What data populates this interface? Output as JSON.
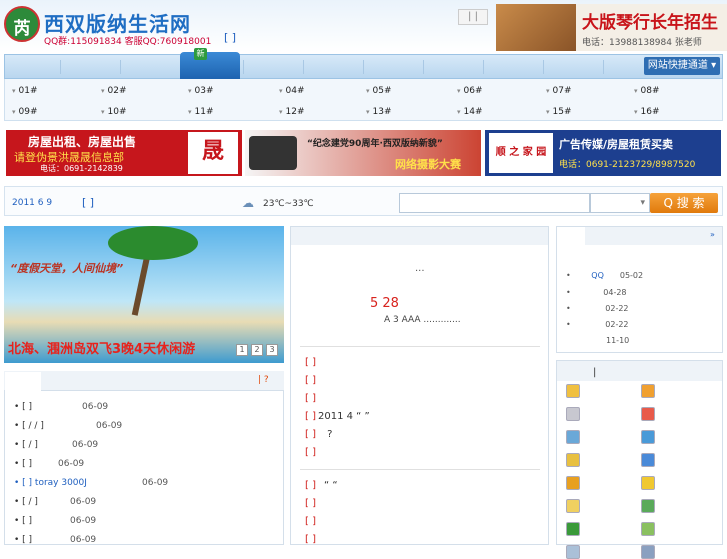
{
  "header": {
    "logo_glyph": "芮",
    "site_name": "西双版纳生活网",
    "qq_line": "QQ群:115091834  客服QQ:760918001",
    "bracket_link": "[ ]",
    "lang_box": "| |"
  },
  "guitar_ad": {
    "title": "大版琴行长年招生",
    "phone": "电话：13988138984 张老师"
  },
  "nav": {
    "badge": "新",
    "quick_button": "网站快捷通道 ▾"
  },
  "subnav": {
    "row1": [
      "01#",
      "02#",
      "03#",
      "04#",
      "05#",
      "06#",
      "07#",
      "08#"
    ],
    "row2": [
      "09#",
      "10#",
      "11#",
      "12#",
      "13#",
      "14#",
      "15#",
      "16#"
    ]
  },
  "banners": {
    "b1_line1": "房屋出租、房屋出售",
    "b1_line2": "请登伪景洪晟晟信息部",
    "b1_phone": "电话：0691-2142839",
    "b1_logo": "晟",
    "b2_line1": "“纪念建党90周年·西双版纳新貌”",
    "b2_line2": "网络摄影大赛",
    "b3_line1": "顺 之 家 园",
    "b3_line2": "广告传媒/房屋租赁买卖",
    "b3_phone": "电话：0691-2123729/8987520"
  },
  "infobar": {
    "date": "2011 6 9",
    "date_bracket": "[ ]",
    "weather_icon": "cloud-rain-icon",
    "weather": "23℃~33℃",
    "search_select": "▾",
    "search_button": "Q 搜 索"
  },
  "slideshow": {
    "slogan": "“度假天堂，人间仙境”",
    "caption": "北海、涠洲岛双飞3晚4天休闲游",
    "pages": [
      "1",
      "2",
      "3"
    ]
  },
  "left_list": {
    "more": "|     ?",
    "items": [
      {
        "text": "[    ]",
        "date": "06-09"
      },
      {
        "text": "[ / / ]",
        "date": "06-09"
      },
      {
        "text": "[  /  ]",
        "date": "06-09"
      },
      {
        "text": "[ ]",
        "date": "06-09"
      },
      {
        "text": "[ ]  toray  3000J",
        "date": "06-09"
      },
      {
        "text": "[  /  ]",
        "date": "06-09"
      },
      {
        "text": "[ ]",
        "date": "06-09"
      },
      {
        "text": "[ ]",
        "date": "06-09"
      }
    ]
  },
  "middle": {
    "dots": "...",
    "date": "5 28",
    "sub": "A 3     AAA .............",
    "items_top": [
      {
        "bracket": "[ ]",
        "text": ""
      },
      {
        "bracket": "[ ]",
        "text": ""
      },
      {
        "bracket": "[ ]",
        "text": ""
      },
      {
        "bracket": "[ ]",
        "text": "2011    4     “ ”"
      },
      {
        "bracket": "[ ]",
        "text": "          ?"
      },
      {
        "bracket": "[ ]",
        "text": ""
      }
    ],
    "items_bottom": [
      {
        "bracket": "[ ]",
        "text": "“     “"
      },
      {
        "bracket": "[ ]",
        "text": ""
      },
      {
        "bracket": "[ ]",
        "text": ""
      },
      {
        "bracket": "[ ]",
        "text": ""
      }
    ]
  },
  "right_top": {
    "more": "»",
    "items": [
      {
        "text": "QQ",
        "date": "05-02"
      },
      {
        "text": "",
        "date": "04-28"
      },
      {
        "text": "",
        "date": "02-22"
      },
      {
        "text": "",
        "date": "02-22"
      },
      {
        "text": "",
        "date": "11-10"
      }
    ]
  },
  "right_bottom": {
    "label": "|",
    "icon_colors": [
      "#f0c040",
      "#f0a030",
      "#c8c8d0",
      "#e85a4a",
      "#6aa8d8",
      "#4a9ad8",
      "#e8c040",
      "#4a8ad8",
      "#e8a020",
      "#f0c830",
      "#f0d060",
      "#5aaa5a",
      "#3a9a3a",
      "#8ac060",
      "#aac0d8",
      "#8aa0c0"
    ]
  }
}
